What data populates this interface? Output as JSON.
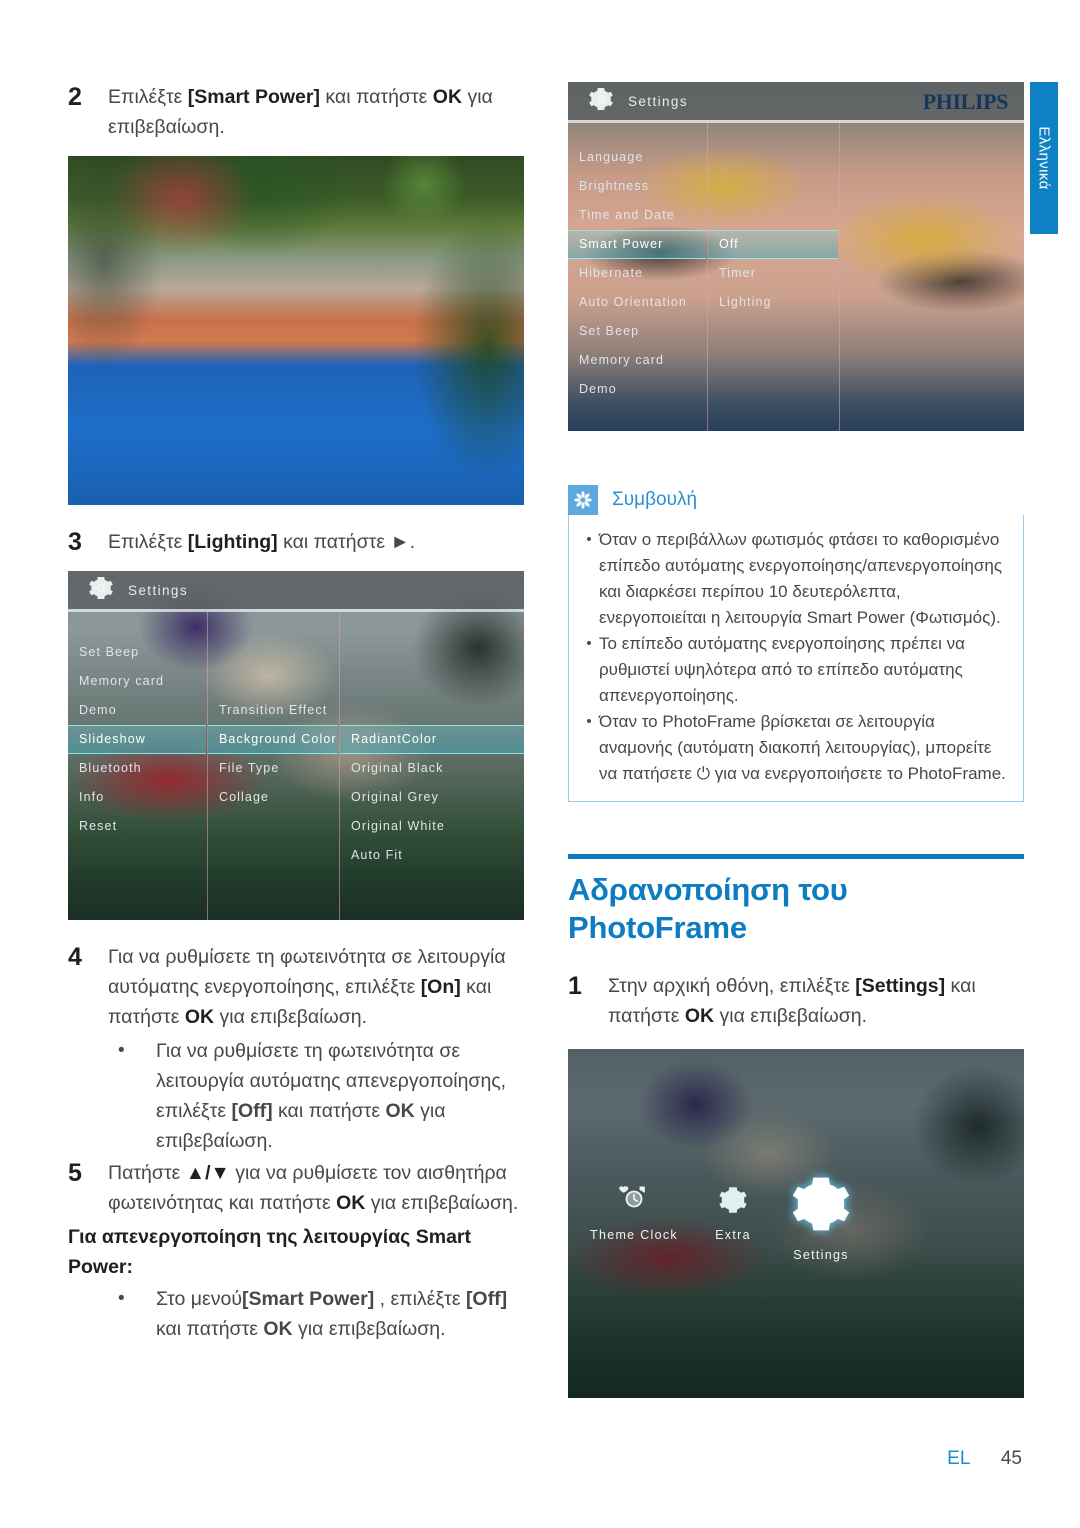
{
  "side_tab": {
    "label": "Ελληνικά"
  },
  "footer": {
    "language_code": "EL",
    "page_number": "45"
  },
  "colors": {
    "philips_blue": "#0d7cc0",
    "tip_blue": "#5ba9de",
    "tip_border": "#9dcbe8",
    "body_text": "#4b4745"
  },
  "left_column": {
    "step2": {
      "number": "2",
      "text_a": "Επιλέξτε ",
      "bold_a": "[Smart Power]",
      "text_b": " και πατήστε ",
      "bold_b": "OK",
      "text_c": " για επιβεβαίωση."
    },
    "photo_garden": {
      "caption": ""
    },
    "step3": {
      "number": "3",
      "text_a": "Επιλέξτε ",
      "bold_a": "[Lighting]",
      "text_b": " και πατήστε ",
      "symbol": "►",
      "text_c": "."
    },
    "screenshot_slideshow": {
      "title": "Settings",
      "gear_icon": "gear-icon",
      "column1": [
        "Set Beep",
        "Memory card",
        "Demo",
        "Slideshow",
        "Bluetooth",
        "Info",
        "Reset"
      ],
      "column1_selected": "Slideshow",
      "column2": [
        "Transition Effect",
        "Background Color",
        "File Type",
        "Collage"
      ],
      "column2_selected": "Background Color",
      "column3": [
        "RadiantColor",
        "Original Black",
        "Original Grey",
        "Original White",
        "Auto Fit"
      ],
      "column3_selected": "RadiantColor"
    },
    "step4": {
      "number": "4",
      "text_a": "Για να ρυθμίσετε τη φωτεινότητα σε λειτουργία αυτόματης ενεργοποίησης, επιλέξτε ",
      "bold_a": "[On]",
      "text_b": " και πατήστε ",
      "bold_b": "OK",
      "text_c": " για επιβεβαίωση.",
      "sub_bullet": {
        "marker": "•",
        "text_a": "Για να ρυθμίσετε τη φωτεινότητα σε λειτουργία αυτόματης απενεργοποίησης, επιλέξτε ",
        "bold_a": "[Off]",
        "text_b": " και πατήστε ",
        "bold_b": "OK",
        "text_c": " για επιβεβαίωση."
      }
    },
    "step5": {
      "number": "5",
      "text_a": "Πατήστε ",
      "bold_a": "▲/▼",
      "text_b": " για να ρυθμίσετε τον αισθητήρα φωτεινότητας και πατήστε ",
      "bold_b": "OK",
      "text_c": " για επιβεβαίωση."
    },
    "disable_heading": "Για απενεργοποίηση της λειτουργίας Smart Power:",
    "disable_bullet": {
      "marker": "•",
      "text_a": "Στο μενού",
      "bold_a": "[Smart Power]",
      "text_b": " , επιλέξτε ",
      "bold_b": "[Off]",
      "text_c": " και πατήστε ",
      "bold_c": "OK",
      "text_d": " για επιβεβαίωση."
    }
  },
  "right_column": {
    "screenshot_settings": {
      "title": "Settings",
      "gear_icon": "gear-icon",
      "brand": "PHILIPS",
      "column1": [
        "Language",
        "Brightness",
        "Time and Date",
        "Smart Power",
        "Hibernate",
        "Auto Orientation",
        "Set Beep",
        "Memory card",
        "Demo"
      ],
      "column1_selected": "Smart Power",
      "column2": [
        "Off",
        "Timer",
        "Lighting"
      ],
      "column2_selected": "Off"
    },
    "tip": {
      "icon": "asterisk-icon",
      "label": "Συμβουλή",
      "items": [
        "Όταν ο περιβάλλων φωτισμός φτάσει το καθορισμένο επίπεδο αυτόματης ενεργοποίησης/απενεργοποίησης και διαρκέσει περίπου 10 δευτερόλεπτα, ενεργοποιείται η λειτουργία Smart Power (Φωτισμός).",
        "Το επίπεδο αυτόματης ενεργοποίησης πρέπει να ρυθμιστεί υψηλότερα από το επίπεδο αυτόματης απενεργοποίησης.",
        "Όταν το PhotoFrame βρίσκεται σε λειτουργία αναμονής (αυτόματη διακοπή λειτουργίας), μπορείτε να πατήσετε ⏻ για να ενεργοποιήσετε το PhotoFrame."
      ],
      "bullet_marker": "•"
    },
    "section": {
      "title": "Αδρανοποίηση του PhotoFrame"
    },
    "step1": {
      "number": "1",
      "text_a": "Στην αρχική οθόνη, επιλέξτε ",
      "bold_a": "[Settings]",
      "text_b": " και πατήστε ",
      "bold_b": "OK",
      "text_c": " για επιβεβαίωση."
    },
    "screenshot_home": {
      "icons": [
        {
          "label": "Theme Clock",
          "icon": "clock-icon"
        },
        {
          "label": "Extra",
          "icon": "gear-icon"
        },
        {
          "label": "Settings",
          "icon": "gear-icon"
        }
      ],
      "selected": "Settings"
    }
  }
}
